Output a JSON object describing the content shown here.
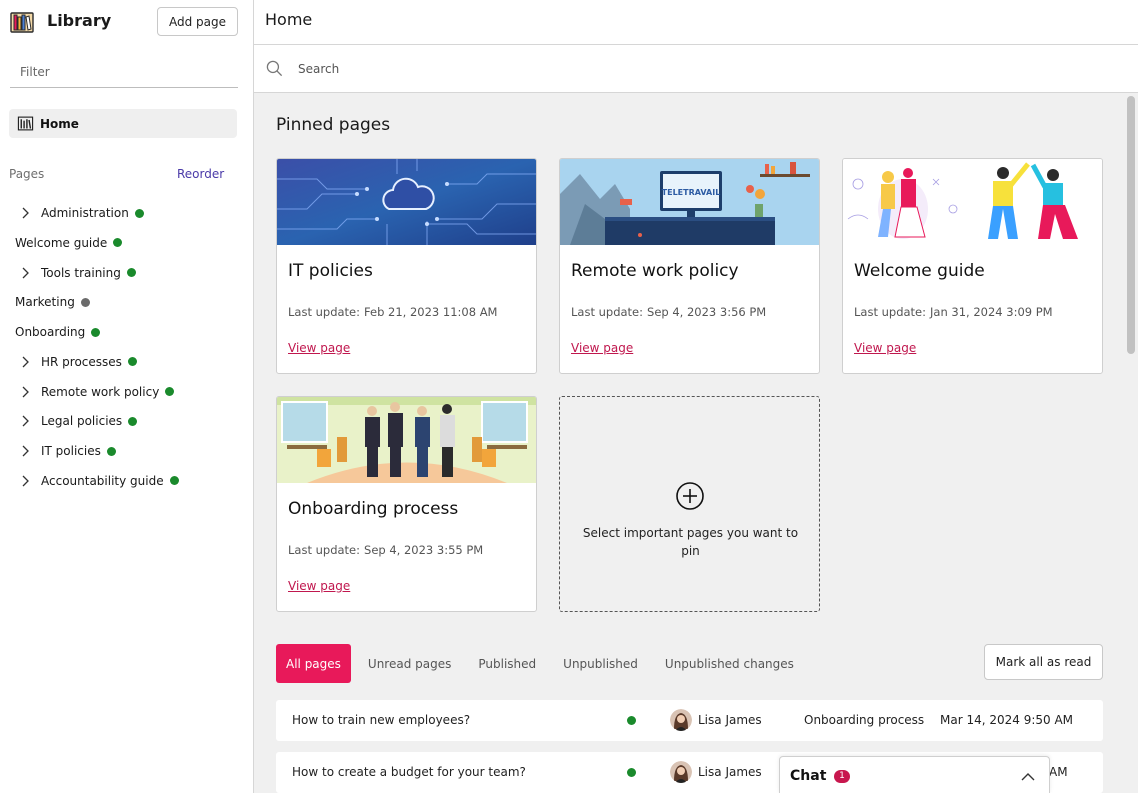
{
  "sidebar": {
    "title": "Library",
    "add_page_label": "Add page",
    "filter_placeholder": "Filter",
    "home_label": "Home",
    "pages_label": "Pages",
    "reorder_label": "Reorder",
    "tree": [
      {
        "label": "Administration",
        "expandable": true,
        "status": "published"
      },
      {
        "label": "Welcome guide",
        "expandable": false,
        "status": "published"
      },
      {
        "label": "Tools training",
        "expandable": true,
        "status": "published"
      },
      {
        "label": "Marketing",
        "expandable": false,
        "status": "unpublished"
      },
      {
        "label": "Onboarding",
        "expandable": false,
        "status": "published"
      },
      {
        "label": "HR processes",
        "expandable": true,
        "status": "published"
      },
      {
        "label": "Remote work policy",
        "expandable": true,
        "status": "published"
      },
      {
        "label": "Legal policies",
        "expandable": true,
        "status": "published"
      },
      {
        "label": "IT policies",
        "expandable": true,
        "status": "published"
      },
      {
        "label": "Accountability guide",
        "expandable": true,
        "status": "published"
      }
    ]
  },
  "header": {
    "title": "Home"
  },
  "search": {
    "placeholder": "Search"
  },
  "pinned": {
    "title": "Pinned pages",
    "update_label": "Last update:",
    "link_label": "View page",
    "cards": [
      {
        "title": "IT policies",
        "updated": "Feb 21, 2023 11:08 AM",
        "image": "circuit-cloud"
      },
      {
        "title": "Remote work policy",
        "updated": "Sep 4, 2023 3:56 PM",
        "image": "teletravail-desk",
        "image_text": "TELETRAVAIL"
      },
      {
        "title": "Welcome guide",
        "updated": "Jan 31, 2024 3:09 PM",
        "image": "people-high-five"
      },
      {
        "title": "Onboarding process",
        "updated": "Sep 4, 2023 3:55 PM",
        "image": "office-handshake"
      }
    ],
    "add_text": "Select important pages you want to pin"
  },
  "tabs": [
    {
      "label": "All pages",
      "active": true
    },
    {
      "label": "Unread pages",
      "active": false
    },
    {
      "label": "Published",
      "active": false
    },
    {
      "label": "Unpublished",
      "active": false
    },
    {
      "label": "Unpublished changes",
      "active": false
    }
  ],
  "mark_all_label": "Mark all as read",
  "rows": [
    {
      "question": "How to train new employees?",
      "author": "Lisa James",
      "page": "Onboarding process",
      "date": "Mar 14, 2024 9:50 AM"
    },
    {
      "question": "How to create a budget for your team?",
      "author": "Lisa James",
      "page": "",
      "date": "AM"
    }
  ],
  "chat": {
    "title": "Chat",
    "badge": "1"
  },
  "colors": {
    "accent": "#e8195a",
    "link": "#c0174e",
    "published_dot": "#1a8a2c",
    "unpublished_dot": "#6b6b6b",
    "reorder": "#4a3aa8"
  }
}
